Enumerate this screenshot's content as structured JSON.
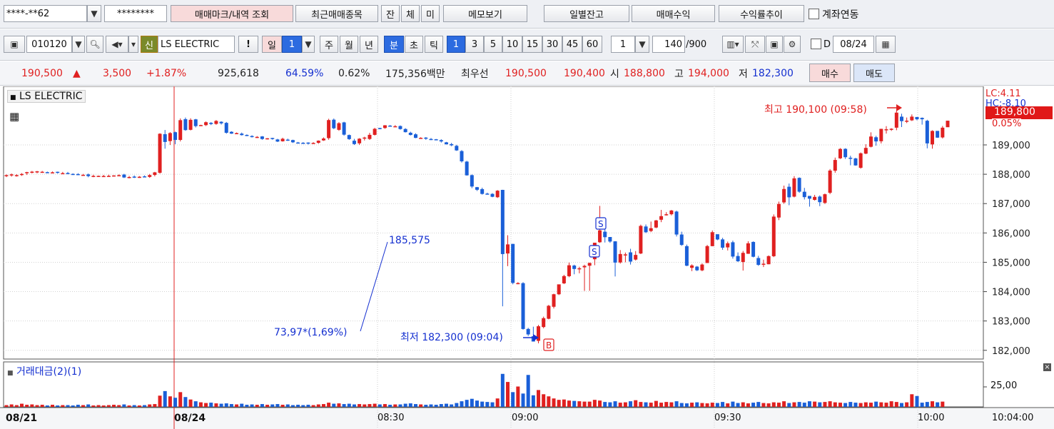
{
  "toolbar": {
    "account_number": "****-**62",
    "password_mask": "********",
    "trade_mark_button": "매매마크/내역 조회",
    "recent_items_button": "최근매매종목",
    "tab_balance": "잔",
    "tab_executed": "체",
    "tab_unfilled": "미",
    "memo_button": "메모보기",
    "daily_balance_button": "일별잔고",
    "trading_profit_button": "매매수익",
    "return_trend_button": "수익률추이",
    "account_link_label": "계좌연동"
  },
  "chart_toolbar": {
    "stock_code": "010120",
    "new_badge": "신",
    "stock_name": "LS ELECTRIC",
    "exclaim": "!",
    "period_day": "일",
    "period_value": "1",
    "period_week": "주",
    "period_month": "월",
    "period_year": "년",
    "period_minute": "분",
    "period_second": "초",
    "period_tick": "틱",
    "intervals": [
      "1",
      "3",
      "5",
      "10",
      "15",
      "30",
      "45",
      "60"
    ],
    "interval_value": "1",
    "count_value": "140",
    "count_max": "/900",
    "d_label": "D",
    "date_value": "08/24"
  },
  "quote": {
    "price": "190,500",
    "change": "3,500",
    "change_arrow": "▲",
    "change_pct": "+1.87%",
    "volume": "925,618",
    "volume_ratio": "64.59%",
    "turnover": "0.62%",
    "trade_value": "175,356백만",
    "best_label": "최우선",
    "best_ask": "190,500",
    "best_bid": "190,400",
    "open_label": "시",
    "open": "188,800",
    "high_label": "고",
    "high": "194,000",
    "low_label": "저",
    "low": "182,300",
    "buy_button": "매수",
    "sell_button": "매도"
  },
  "price_panel": {
    "title": "LS ELECTRIC",
    "lc_label": "LC:4.11",
    "hc_label": "HC:-8.10",
    "current_price_tag": "189,800",
    "current_pct_tag": "0.05%",
    "high_annotation": "최고 190,100 (09:58)",
    "low_annotation": "최저 182,300 (09:04)",
    "trend_value": "185,575",
    "trend_change": "73,97*(1,69%)",
    "marker_b": "B",
    "marker_s": "S"
  },
  "volume_panel": {
    "title": "거래대금(2)(1)",
    "axis_label": "25,00"
  },
  "time_axis": {
    "labels": [
      "08/21",
      "08/24",
      "08:30",
      "09:00",
      "09:30",
      "10:00"
    ],
    "corner": "10:04:00"
  },
  "chart_data": {
    "type": "candlestick",
    "ylim": [
      181800,
      190800
    ],
    "y_ticks": [
      182000,
      183000,
      184000,
      185000,
      186000,
      187000,
      188000,
      189000
    ],
    "up_color": "#e02020",
    "down_color": "#1a5fd8",
    "candles": [
      [
        187952,
        187970,
        187903,
        187994
      ],
      [
        187983,
        187995,
        187920,
        188024
      ],
      [
        187945,
        187970,
        187920,
        188000
      ],
      [
        187985,
        188009,
        187946,
        188038
      ],
      [
        188036,
        188072,
        187976,
        188083
      ],
      [
        188072,
        188087,
        188031,
        188112
      ],
      [
        188085,
        188099,
        188033,
        188113
      ],
      [
        188080,
        188084,
        188052,
        188112
      ],
      [
        188072,
        188065,
        188038,
        188090
      ],
      [
        188049,
        188066,
        188039,
        188095
      ],
      [
        188083,
        188048,
        188024,
        188090
      ],
      [
        188035,
        188037,
        188019,
        188080
      ],
      [
        188041,
        188026,
        188001,
        188080
      ],
      [
        188011,
        188009,
        187975,
        188031
      ],
      [
        188006,
        187993,
        187972,
        188035
      ],
      [
        187980,
        187981,
        187964,
        188011
      ],
      [
        187994,
        187937,
        187898,
        188024
      ],
      [
        187938,
        187943,
        187901,
        187982
      ],
      [
        187939,
        187944,
        187912,
        187955
      ],
      [
        187923,
        187940,
        187910,
        187978
      ],
      [
        187941,
        187944,
        187919,
        187984
      ],
      [
        187942,
        187959,
        187921,
        187966
      ],
      [
        187954,
        187967,
        187934,
        187996
      ],
      [
        187989,
        187890,
        187872,
        188014
      ],
      [
        187870,
        187906,
        187861,
        187943
      ],
      [
        187920,
        187900,
        187872,
        187958
      ],
      [
        187876,
        187915,
        187876,
        187937
      ],
      [
        187928,
        187917,
        187896,
        187960
      ],
      [
        187909,
        187972,
        187877,
        188008
      ],
      [
        187976,
        188064,
        187928,
        188081
      ],
      [
        188050,
        189380,
        188020,
        189398
      ],
      [
        189365,
        189100,
        188871,
        189509
      ],
      [
        189131,
        189404,
        188998,
        189436
      ],
      [
        189433,
        189170,
        189025,
        189453
      ],
      [
        189170,
        189843,
        189118,
        189902
      ],
      [
        189878,
        189505,
        189481,
        189933
      ],
      [
        189514,
        189854,
        189494,
        189906
      ],
      [
        189871,
        189641,
        189595,
        189888
      ],
      [
        189656,
        189676,
        189644,
        189686
      ],
      [
        189674,
        189773,
        189644,
        189800
      ],
      [
        189752,
        189712,
        189676,
        189777
      ],
      [
        189715,
        189817,
        189687,
        189846
      ],
      [
        189788,
        189735,
        189694,
        189806
      ],
      [
        189751,
        189413,
        189382,
        189782
      ],
      [
        189447,
        189384,
        189376,
        189465
      ],
      [
        189381,
        189401,
        189371,
        189423
      ],
      [
        189384,
        189334,
        189319,
        189421
      ],
      [
        189340,
        189320,
        189298,
        189359
      ],
      [
        189302,
        189283,
        189252,
        189329
      ],
      [
        189263,
        189273,
        189234,
        189300
      ],
      [
        189289,
        189201,
        189176,
        189300
      ],
      [
        189189,
        189225,
        189186,
        189231
      ],
      [
        189236,
        189211,
        189177,
        189243
      ],
      [
        189186,
        189114,
        189097,
        189207
      ],
      [
        189123,
        189209,
        189112,
        189245
      ],
      [
        189179,
        189167,
        189138,
        189213
      ],
      [
        189165,
        189089,
        189067,
        189178
      ],
      [
        189081,
        189066,
        189053,
        189102
      ],
      [
        189072,
        189062,
        189038,
        189095
      ],
      [
        189079,
        189051,
        189013,
        189089
      ],
      [
        189043,
        189067,
        189039,
        189092
      ],
      [
        189070,
        189143,
        189041,
        189155
      ],
      [
        189153,
        189218,
        189137,
        189255
      ],
      [
        189231,
        189846,
        189176,
        189891
      ],
      [
        189859,
        189567,
        189536,
        189899
      ],
      [
        189513,
        189740,
        189480,
        189775
      ],
      [
        189767,
        189349,
        189315,
        189789
      ],
      [
        189336,
        189198,
        189171,
        189354
      ],
      [
        189143,
        189029,
        188999,
        189206
      ],
      [
        189054,
        189212,
        189000,
        189230
      ],
      [
        189242,
        189250,
        189150,
        189278
      ],
      [
        189202,
        189343,
        189169,
        189412
      ],
      [
        189342,
        189548,
        189320,
        189582
      ],
      [
        189575,
        189556,
        189533,
        189582
      ],
      [
        189576,
        189668,
        189550,
        189675
      ],
      [
        189657,
        189631,
        189621,
        189677
      ],
      [
        189632,
        189636,
        189616,
        189675
      ],
      [
        189643,
        189540,
        189519,
        189664
      ],
      [
        189542,
        189434,
        189423,
        189571
      ],
      [
        189415,
        189338,
        189322,
        189450
      ],
      [
        189361,
        189239,
        189229,
        189397
      ],
      [
        189219,
        189240,
        189208,
        189262
      ],
      [
        189248,
        189210,
        189173,
        189268
      ],
      [
        189202,
        189200,
        189164,
        189235
      ],
      [
        189192,
        189173,
        189160,
        189202
      ],
      [
        189164,
        189118,
        189080,
        189192
      ],
      [
        189088,
        189020,
        189015,
        189103
      ],
      [
        189027,
        188986,
        188955,
        189069
      ],
      [
        188968,
        188812,
        188796,
        189004
      ],
      [
        188790,
        188440,
        188398,
        188823
      ],
      [
        188431,
        187963,
        187953,
        188458
      ],
      [
        187970,
        187582,
        187526,
        187994
      ],
      [
        187560,
        187471,
        187431,
        187569
      ],
      [
        187494,
        187330,
        187307,
        187542
      ],
      [
        187340,
        187320,
        187311,
        187372
      ],
      [
        187331,
        187232,
        187216,
        187356
      ],
      [
        187217,
        187440,
        187193,
        187460
      ],
      [
        187467,
        185280,
        183500,
        187470
      ],
      [
        185300,
        185610,
        184868,
        185922
      ],
      [
        185626,
        184296,
        184250,
        185630
      ],
      [
        184280,
        184291,
        184252,
        184323
      ],
      [
        184289,
        182727,
        182704,
        184322
      ],
      [
        182729,
        182542,
        182489,
        182766
      ],
      [
        182480,
        182300,
        182300,
        182805
      ],
      [
        182323,
        182820,
        182238,
        182867
      ],
      [
        182793,
        183096,
        182751,
        183148
      ],
      [
        183075,
        183518,
        183057,
        183548
      ],
      [
        183484,
        183911,
        183426,
        183929
      ],
      [
        183910,
        184248,
        183883,
        184244
      ],
      [
        184282,
        184530,
        184258,
        184573
      ],
      [
        184526,
        184898,
        184493,
        184990
      ],
      [
        184889,
        184772,
        184591,
        184918
      ],
      [
        184773,
        184796,
        184624,
        184848
      ],
      [
        184828,
        184878,
        184026,
        184918
      ],
      [
        184883,
        184978,
        184028,
        184988
      ],
      [
        185104,
        185667,
        184900,
        185665
      ],
      [
        185683,
        186089,
        185661,
        186922
      ],
      [
        186042,
        185855,
        185674,
        186137
      ],
      [
        185862,
        185707,
        185663,
        185768
      ],
      [
        185714,
        184990,
        184517,
        185721
      ],
      [
        184994,
        185282,
        184955,
        185416
      ],
      [
        185242,
        185269,
        185000,
        185332
      ],
      [
        185338,
        185024,
        184923,
        185460
      ],
      [
        185092,
        185251,
        185059,
        185383
      ],
      [
        185300,
        186240,
        185278,
        186283
      ],
      [
        186220,
        186024,
        185999,
        186288
      ],
      [
        186065,
        186162,
        186028,
        186388
      ],
      [
        186184,
        186427,
        186161,
        186444
      ],
      [
        186449,
        186573,
        186368,
        186786
      ],
      [
        186617,
        186637,
        186592,
        186709
      ],
      [
        186637,
        186765,
        186598,
        186784
      ],
      [
        186729,
        185946,
        185879,
        186760
      ],
      [
        185947,
        185591,
        185560,
        186042
      ],
      [
        185550,
        184883,
        184868,
        185603
      ],
      [
        184810,
        184893,
        184698,
        184932
      ],
      [
        184852,
        184727,
        184701,
        184874
      ],
      [
        184725,
        184923,
        184695,
        184963
      ],
      [
        184975,
        185552,
        184978,
        185591
      ],
      [
        185550,
        186025,
        185549,
        186084
      ],
      [
        185957,
        185777,
        185752,
        185910
      ],
      [
        185780,
        185498,
        185425,
        185835
      ],
      [
        185508,
        185648,
        185403,
        185706
      ],
      [
        185682,
        185195,
        185125,
        185738
      ],
      [
        185214,
        185035,
        185010,
        185336
      ],
      [
        185009,
        185322,
        184718,
        185386
      ],
      [
        185290,
        185647,
        185287,
        185716
      ],
      [
        185694,
        185188,
        185168,
        185712
      ],
      [
        185145,
        184911,
        184880,
        185220
      ],
      [
        184937,
        184952,
        184838,
        185089
      ],
      [
        184933,
        185210,
        184932,
        185235
      ],
      [
        185207,
        186557,
        185176,
        186631
      ],
      [
        186525,
        186988,
        186437,
        187068
      ],
      [
        187041,
        187498,
        186993,
        187613
      ],
      [
        187574,
        187214,
        186945,
        187683
      ],
      [
        187237,
        187860,
        187211,
        187936
      ],
      [
        187877,
        187406,
        187368,
        187894
      ],
      [
        187404,
        187220,
        187140,
        187535
      ],
      [
        187262,
        187167,
        186896,
        187261
      ],
      [
        187126,
        187229,
        187103,
        187297
      ],
      [
        187239,
        187049,
        186913,
        187280
      ],
      [
        187024,
        187319,
        186987,
        187342
      ],
      [
        187369,
        188126,
        187321,
        188177
      ],
      [
        188120,
        188487,
        188050,
        188568
      ],
      [
        188542,
        188863,
        188520,
        188891
      ],
      [
        188866,
        188581,
        188522,
        188886
      ],
      [
        188563,
        188543,
        188305,
        188631
      ],
      [
        188540,
        188301,
        188289,
        188561
      ],
      [
        188220,
        188715,
        188190,
        188742
      ],
      [
        188702,
        188898,
        188686,
        189023
      ],
      [
        188936,
        189286,
        188914,
        189429
      ],
      [
        189261,
        189119,
        188973,
        189310
      ],
      [
        189124,
        189547,
        189049,
        189550
      ],
      [
        189498,
        189533,
        189385,
        189639
      ],
      [
        189524,
        189550,
        189477,
        189568
      ],
      [
        189587,
        190100,
        189500,
        190172
      ],
      [
        189963,
        189810,
        189608,
        190062
      ],
      [
        189815,
        189825,
        189744,
        189934
      ],
      [
        189837,
        189964,
        189814,
        190039
      ],
      [
        189951,
        189873,
        189838,
        189929
      ],
      [
        189921,
        189874,
        189691,
        189936
      ],
      [
        189823,
        189051,
        188883,
        189856
      ],
      [
        189017,
        189476,
        188871,
        189499
      ],
      [
        189478,
        189247,
        189240,
        189472
      ],
      [
        189255,
        189587,
        189218,
        189644
      ],
      [
        189603,
        189825,
        189614,
        189826
      ]
    ],
    "volume": [
      0.5,
      0.7,
      0.5,
      0.9,
      0.6,
      0.7,
      0.5,
      0.6,
      0.4,
      0.6,
      0.4,
      0.5,
      0.5,
      0.4,
      0.6,
      0.5,
      0.7,
      0.4,
      0.5,
      0.4,
      0.5,
      0.6,
      0.5,
      0.7,
      0.4,
      0.5,
      0.4,
      0.5,
      0.7,
      0.8,
      3.2,
      4.5,
      3.0,
      2.6,
      4.2,
      2.8,
      2.1,
      1.6,
      1.3,
      1.1,
      1.2,
      1.0,
      0.9,
      1.0,
      0.8,
      0.7,
      0.9,
      0.6,
      0.7,
      0.6,
      0.8,
      0.6,
      0.7,
      0.8,
      0.6,
      0.7,
      0.5,
      0.6,
      0.5,
      0.6,
      0.5,
      0.7,
      0.8,
      1.2,
      0.9,
      1.0,
      0.8,
      0.9,
      0.7,
      0.8,
      0.7,
      0.8,
      0.9,
      0.7,
      0.8,
      0.6,
      0.7,
      0.7,
      0.9,
      1.0,
      0.8,
      0.7,
      0.6,
      0.7,
      0.6,
      0.8,
      0.9,
      0.7,
      1.1,
      1.6,
      2.0,
      2.3,
      1.8,
      1.5,
      1.4,
      1.3,
      2.4,
      9.4,
      7.1,
      4.2,
      5.8,
      3.8,
      9.1,
      3.3,
      4.8,
      3.6,
      3.0,
      2.4,
      2.0,
      2.1,
      1.8,
      1.7,
      1.6,
      1.5,
      1.5,
      2.0,
      1.8,
      1.4,
      1.3,
      1.6,
      1.2,
      1.3,
      1.6,
      1.9,
      1.4,
      1.3,
      1.2,
      1.7,
      1.2,
      1.4,
      1.3,
      1.6,
      1.1,
      1.0,
      1.2,
      1.3,
      1.1,
      1.0,
      1.2,
      1.1,
      1.4,
      1.0,
      1.5,
      1.1,
      1.3,
      1.0,
      1.2,
      1.4,
      1.1,
      1.0,
      1.3,
      1.2,
      1.6,
      1.1,
      1.3,
      1.4,
      1.2,
      1.6,
      1.5,
      1.3,
      1.4,
      1.6,
      1.3,
      1.2,
      1.1,
      1.4,
      1.2,
      1.1,
      1.3,
      1.2,
      1.5,
      1.3,
      1.2,
      1.6,
      1.4,
      1.1,
      1.3,
      3.6,
      3.1,
      1.2,
      1.4,
      1.6,
      1.3,
      1.5
    ]
  }
}
